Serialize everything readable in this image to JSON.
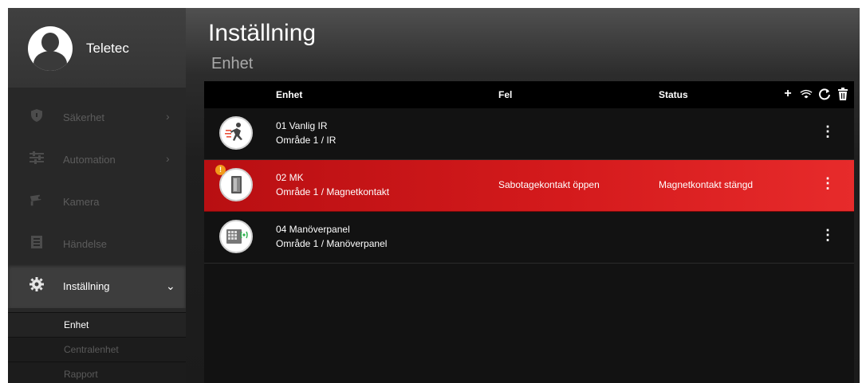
{
  "profile": {
    "name": "Teletec"
  },
  "sidebar": {
    "items": [
      {
        "label": "Säkerhet",
        "icon": "shield-icon",
        "chevron": "›"
      },
      {
        "label": "Automation",
        "icon": "sliders-icon",
        "chevron": "›"
      },
      {
        "label": "Kamera",
        "icon": "camera-icon"
      },
      {
        "label": "Händelse",
        "icon": "list-icon"
      },
      {
        "label": "Inställning",
        "icon": "gear-icon",
        "chevron": "⌄"
      }
    ],
    "subitems": [
      {
        "label": "Enhet"
      },
      {
        "label": "Centralenhet"
      },
      {
        "label": "Rapport"
      }
    ]
  },
  "page": {
    "title": "Inställning",
    "subtitle": "Enhet"
  },
  "table": {
    "headers": {
      "device": "Enhet",
      "fault": "Fel",
      "status": "Status"
    },
    "toolbar": [
      {
        "icon": "plus-icon",
        "glyph": "+"
      },
      {
        "icon": "wifi-eye-icon",
        "glyph": "≋"
      },
      {
        "icon": "refresh-icon",
        "glyph": "C"
      },
      {
        "icon": "trash-icon",
        "glyph": "🗑"
      }
    ],
    "rows": [
      {
        "name": "01 Vanlig IR",
        "area": "Område 1 / IR",
        "fault": "",
        "status": "",
        "icon": "motion-sensor-icon",
        "alarm": false
      },
      {
        "name": "02 MK",
        "area": "Område 1 / Magnetkontakt",
        "fault": "Sabotagekontakt öppen",
        "status": "Magnetkontakt stängd",
        "icon": "door-contact-icon",
        "alarm": true,
        "badge": "!"
      },
      {
        "name": "04 Manöverpanel",
        "area": "Område 1 / Manöverpanel",
        "fault": "",
        "status": "",
        "icon": "keypad-icon",
        "alarm": false
      }
    ],
    "more_glyph": "⋮"
  },
  "colors": {
    "alarm_row": "#d41a1c",
    "badge": "#f29a1b",
    "background": "#1b1b1b"
  }
}
